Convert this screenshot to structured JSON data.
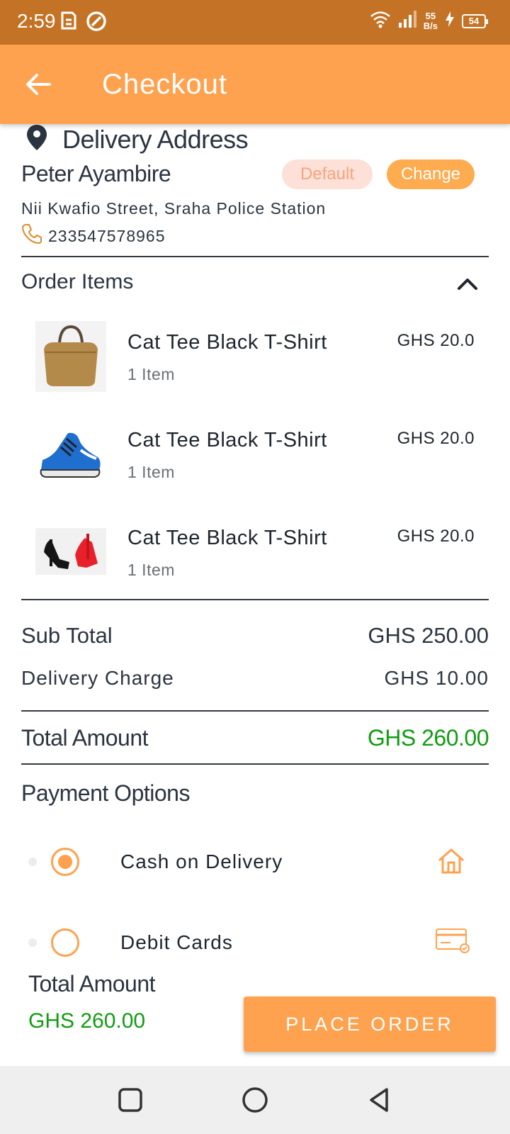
{
  "status_bar": {
    "time": "2:59",
    "net_speed_value": "55",
    "net_speed_unit": "B/s",
    "battery": "54"
  },
  "header": {
    "title": "Checkout",
    "back_icon": "arrow-left-icon"
  },
  "address": {
    "section_title": "Delivery Address",
    "name": "Peter Ayambire",
    "default_label": "Default",
    "change_label": "Change",
    "street": "Nii Kwafio Street, Sraha Police Station",
    "phone": "233547578965"
  },
  "order": {
    "section_title": "Order Items",
    "items": [
      {
        "name": "Cat Tee Black T-Shirt",
        "qty": "1 Item",
        "price": "GHS 20.0",
        "image": "handbag-image"
      },
      {
        "name": "Cat Tee Black T-Shirt",
        "qty": "1 Item",
        "price": "GHS 20.0",
        "image": "sneaker-image"
      },
      {
        "name": "Cat Tee Black T-Shirt",
        "qty": "1 Item",
        "price": "GHS 20.0",
        "image": "heels-image"
      }
    ]
  },
  "summary": {
    "subtotal_label": "Sub Total",
    "subtotal_value": "GHS 250.00",
    "delivery_label": "Delivery Charge",
    "delivery_value": "GHS 10.00",
    "total_label": "Total Amount",
    "total_value": "GHS 260.00"
  },
  "payment": {
    "section_title": "Payment Options",
    "options": [
      {
        "label": "Cash on Delivery",
        "selected": true,
        "icon": "home-icon"
      },
      {
        "label": "Debit Cards",
        "selected": false,
        "icon": "credit-card-icon"
      }
    ]
  },
  "bottom": {
    "total_label": "Total Amount",
    "total_value": "GHS 260.00",
    "button_label": "PLACE ORDER"
  },
  "colors": {
    "accent": "#ffa24f",
    "status_bar": "#c47326",
    "total_green": "#129c12"
  }
}
